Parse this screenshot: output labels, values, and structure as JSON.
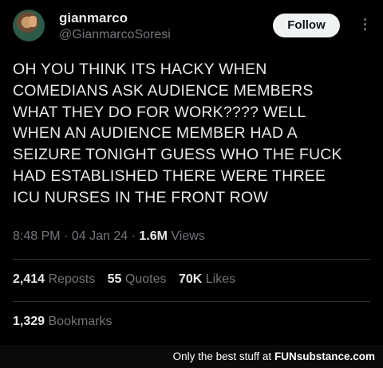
{
  "author": {
    "name": "gianmarco",
    "handle": "@GianmarcoSoresi"
  },
  "follow_label": "Follow",
  "tweet_lines": [
    "OH YOU THINK ITS HACKY WHEN",
    "COMEDIANS ASK AUDIENCE MEMBERS",
    "WHAT THEY DO FOR WORK???? WELL",
    "WHEN AN AUDIENCE MEMBER HAD A",
    "SEIZURE TONIGHT GUESS WHO THE FUCK",
    "HAD ESTABLISHED THERE WERE THREE",
    "ICU NURSES IN THE FRONT ROW"
  ],
  "meta": {
    "time": "8:48 PM",
    "sep": "·",
    "date": "04 Jan 24",
    "views_count": "1.6M",
    "views_label": "Views"
  },
  "stats": {
    "reposts_count": "2,414",
    "reposts_label": "Reposts",
    "quotes_count": "55",
    "quotes_label": "Quotes",
    "likes_count": "70K",
    "likes_label": "Likes",
    "bookmarks_count": "1,329",
    "bookmarks_label": "Bookmarks"
  },
  "footer": {
    "text": "Only the best stuff at",
    "brand_fun": "FUN",
    "brand_rest": "substance.com"
  }
}
